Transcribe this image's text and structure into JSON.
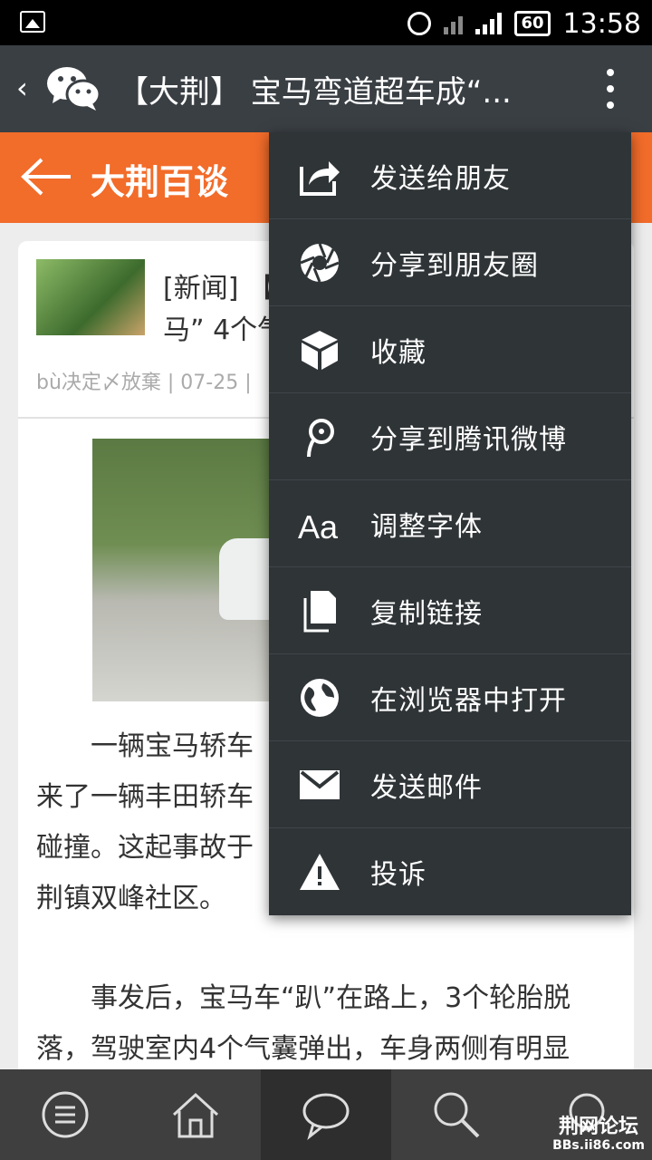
{
  "status_bar": {
    "battery": "60",
    "time": "13:58"
  },
  "wechat_header": {
    "back_symbol": "‹",
    "title": "【大荆】 宝马弯道超车成“..."
  },
  "page_header": {
    "title": "大荆百谈"
  },
  "post": {
    "title_line1": "[新闻] 【",
    "title_line2": "马” 4个气",
    "meta": "bù决定〆放棄 | 07-25 |",
    "paragraphs": [
      "　　一辆宝马轿车",
      "来了一辆丰田轿车",
      "碰撞。这起事故于",
      "荆镇双峰社区。",
      "",
      "　　事发后，宝马车“趴”在路上，3个轮胎脱",
      "落，驾驶室内4个气囊弹出，车身两侧有明显"
    ]
  },
  "menu": {
    "items": [
      {
        "label": "发送给朋友",
        "icon": "share-icon"
      },
      {
        "label": "分享到朋友圈",
        "icon": "moments-icon"
      },
      {
        "label": "收藏",
        "icon": "favorite-cube-icon"
      },
      {
        "label": "分享到腾讯微博",
        "icon": "tencent-weibo-icon"
      },
      {
        "label": "调整字体",
        "icon": "font-size-icon"
      },
      {
        "label": "复制链接",
        "icon": "copy-icon"
      },
      {
        "label": "在浏览器中打开",
        "icon": "globe-icon"
      },
      {
        "label": "发送邮件",
        "icon": "mail-icon"
      },
      {
        "label": "投诉",
        "icon": "warning-icon"
      }
    ]
  },
  "bottom_nav": {
    "items": [
      "menu-icon",
      "home-icon",
      "chat-icon",
      "search-icon",
      "bulb-icon"
    ],
    "watermark_line1": "荆网论坛",
    "watermark_line2": "BBs.ii86.com"
  },
  "colors": {
    "orange": "#f26c2a",
    "header_dark": "#3a3f44",
    "menu_bg": "#2f3437"
  }
}
